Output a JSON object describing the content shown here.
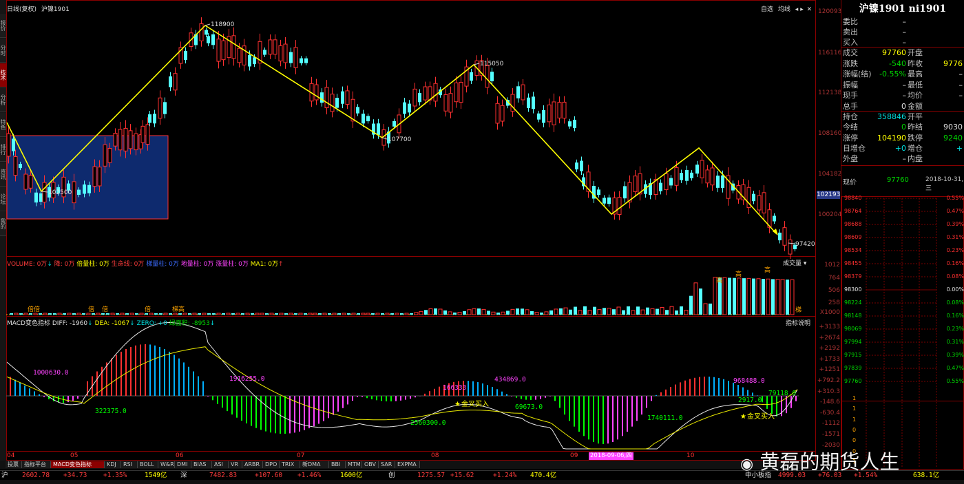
{
  "window": {
    "chart_title": "日线(复权)",
    "contract": "沪镍1901",
    "top_icons": [
      "自选",
      "均线"
    ],
    "right_title": "沪镍1901 ni1901",
    "left_tabs": [
      "报价",
      "分时",
      "技术",
      "分析",
      "特色",
      "排行",
      "资讯",
      "论坛",
      "我的"
    ]
  },
  "price_axis": [
    "120093",
    "116116",
    "112138",
    "108160",
    "104182",
    "100204"
  ],
  "price_current": "102193",
  "annotations": {
    "p118900": "118900",
    "p115050": "115050",
    "p107700": "107700",
    "p102500": "102500",
    "p97420": "97420"
  },
  "volume_header": {
    "label": "VOLUME: 0万",
    "items": [
      "降: 0万",
      "倍量柱: 0万",
      "生命线: 0万",
      "梯量柱: 0万",
      "地量柱: 0万",
      "涨量柱: 0万",
      "MA1: 0万"
    ],
    "axis": [
      "1012",
      "764",
      "506",
      "258",
      "X1000"
    ],
    "dropdown": "成交量",
    "tags": [
      "倍倍",
      "倍",
      "倍",
      "倍",
      "梯高",
      "高",
      "高",
      "高",
      "梯"
    ]
  },
  "macd_header": {
    "label": "MACD变色指标",
    "diff": "DIFF: -1960",
    "dea": "DEA: -1067",
    "zero": "ZERO: +0",
    "green": "绿面积: -8953",
    "explain": "指标说明",
    "axis": [
      "+3133",
      "+2674",
      "+2192",
      "+1733",
      "+1251",
      "+792.2",
      "+310.3",
      "-148.6",
      "-630.4",
      "-1112",
      "-1571",
      "-2030"
    ],
    "labels": [
      "1000630.0",
      "322375.0",
      "1916255.0",
      "2560300.0",
      "166333",
      "434869.0",
      "69673.0",
      "968488.0",
      "1740111.0",
      "2917.0",
      "79118.0"
    ],
    "golden": "金叉买入"
  },
  "date_axis": [
    "04",
    "05",
    "06",
    "07",
    "08",
    "09",
    "10"
  ],
  "date_selected": "2018-09-06,四",
  "bottom_tabs": [
    "投票",
    "指标平台",
    "MACD变色指标",
    "KDJ",
    "RSI",
    "BOLL",
    "W&R",
    "DMI",
    "BIAS",
    "ASI",
    "VR",
    "ARBR",
    "DPO",
    "TRIX",
    "新DMA",
    "BBI",
    "MTM",
    "OBV",
    "SAR",
    "EXPMA"
  ],
  "quote_panel": {
    "rows1": [
      {
        "l1": "委比",
        "v1": "–"
      },
      {
        "l1": "卖出",
        "v1": "–"
      },
      {
        "l1": "买入",
        "v1": "–"
      }
    ],
    "rows2": [
      {
        "l1": "成交",
        "v1": "97760",
        "c1": "yl",
        "l2": "开盘",
        "v2": "",
        "c2": "wh"
      },
      {
        "l1": "涨跌",
        "v1": "-540",
        "c1": "dn",
        "l2": "昨收",
        "v2": "9776",
        "c2": "yl"
      },
      {
        "l1": "涨幅(结)",
        "v1": "-0.55%",
        "c1": "dn",
        "l2": "最高",
        "v2": "–",
        "c2": "wh"
      },
      {
        "l1": "振幅",
        "v1": "–",
        "c1": "wh",
        "l2": "最低",
        "v2": "–",
        "c2": "wh"
      },
      {
        "l1": "现手",
        "v1": "–",
        "c1": "wh",
        "l2": "均价",
        "v2": "–",
        "c2": "wh"
      },
      {
        "l1": "总手",
        "v1": "0",
        "c1": "wh",
        "l2": "金额",
        "v2": "",
        "c2": "wh"
      }
    ],
    "rows3": [
      {
        "l1": "持仓",
        "v1": "358846",
        "c1": "cy",
        "l2": "开平",
        "v2": "",
        "c2": "wh"
      },
      {
        "l1": "今结",
        "v1": "0",
        "c1": "dn",
        "l2": "昨结",
        "v2": "9030",
        "c2": "wh"
      },
      {
        "l1": "涨停",
        "v1": "104190",
        "c1": "yl",
        "l2": "跌停",
        "v2": "9240",
        "c2": "dn"
      },
      {
        "l1": "日增仓",
        "v1": "+0",
        "c1": "cy",
        "l2": "增仓",
        "v2": "+",
        "c2": "cy"
      },
      {
        "l1": "外盘",
        "v1": "–",
        "c1": "wh",
        "l2": "内盘",
        "v2": "",
        "c2": "wh"
      }
    ],
    "now_label": "现价",
    "now_value": "97760",
    "now_date": "2018-10-31,三",
    "mini_prices": [
      "98840",
      "98764",
      "98688",
      "98609",
      "98534",
      "98455",
      "98379",
      "98300",
      "98224",
      "98148",
      "98069",
      "97994",
      "97915",
      "97839",
      "97760"
    ],
    "mini_pcts": [
      "0.55%",
      "0.47%",
      "0.39%",
      "0.31%",
      "0.23%",
      "0.16%",
      "0.08%",
      "0.00%",
      "0.08%",
      "0.16%",
      "0.23%",
      "0.31%",
      "0.39%",
      "0.47%",
      "0.55%"
    ],
    "mini_vol": [
      "1",
      "1",
      "1",
      "0",
      "0",
      "0",
      "1"
    ]
  },
  "status_bar": [
    {
      "t": "沪",
      "c": "wh"
    },
    {
      "t": "2602.78",
      "c": "up"
    },
    {
      "t": "+34.73",
      "c": "up"
    },
    {
      "t": "+1.35%",
      "c": "up"
    },
    {
      "t": "1549亿",
      "c": "yl"
    },
    {
      "t": "深",
      "c": "wh"
    },
    {
      "t": "7482.83",
      "c": "up"
    },
    {
      "t": "+107.60",
      "c": "up"
    },
    {
      "t": "+1.46%",
      "c": "up"
    },
    {
      "t": "1600亿",
      "c": "yl"
    },
    {
      "t": "创",
      "c": "wh"
    },
    {
      "t": "1275.57",
      "c": "up"
    },
    {
      "t": "+15.62",
      "c": "up"
    },
    {
      "t": "+1.24%",
      "c": "up"
    },
    {
      "t": "470.4亿",
      "c": "yl"
    },
    {
      "t": "中小板指",
      "c": "wh"
    },
    {
      "t": "4999.03",
      "c": "up"
    },
    {
      "t": "+76.03",
      "c": "up"
    },
    {
      "t": "+1.54%",
      "c": "up"
    },
    {
      "t": "638.1亿",
      "c": "yl"
    }
  ],
  "watermark": "黄磊的期货人生"
}
